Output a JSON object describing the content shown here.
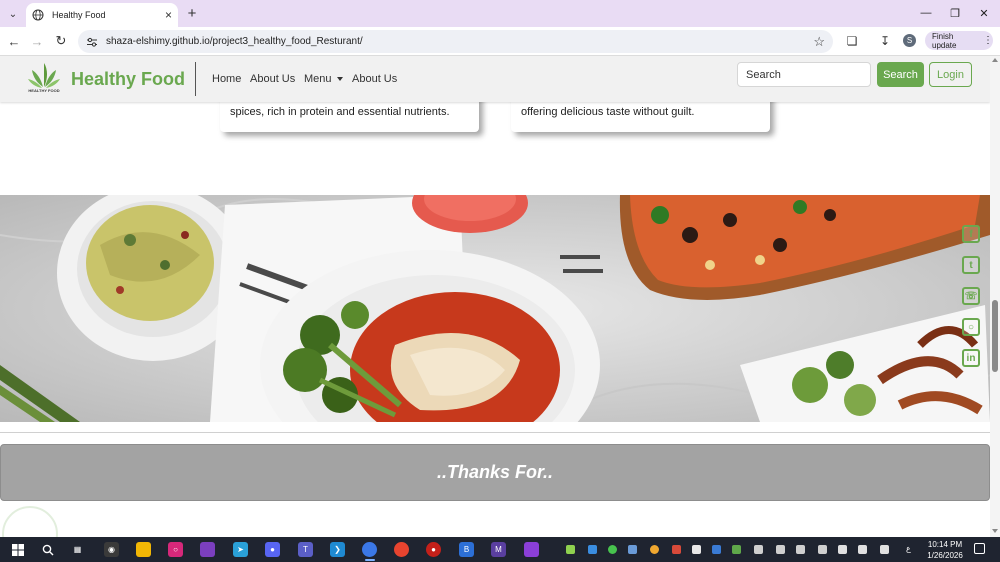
{
  "browser": {
    "tab_title": "Healthy Food",
    "url": "shaza-elshimy.github.io/project3_healthy_food_Resturant/",
    "finish_update_label": "Finish update",
    "profile_initial": "S"
  },
  "site": {
    "brand_name": "Healthy Food",
    "logo_text": "HEALTHY FOOD",
    "nav": {
      "home": "Home",
      "about_us_1": "About Us",
      "menu": "Menu",
      "about_us_2": "About Us"
    },
    "search_placeholder": "Search",
    "search_button": "Search",
    "login_button": "Login",
    "cards": [
      {
        "text": "spices, rich in protein and essential nutrients."
      },
      {
        "text": "offering delicious taste without guilt."
      }
    ],
    "thanks_text": "..Thanks For..",
    "social_icons": [
      "facebook-icon",
      "twitter-icon",
      "whatsapp-icon",
      "instagram-icon",
      "linkedin-icon"
    ]
  },
  "taskbar": {
    "time": "10:14 PM",
    "date": "1/26/2026",
    "language": "ع"
  },
  "colors": {
    "brand_green": "#6aa84f",
    "tab_strip": "#e9dcf4",
    "thanks_bar": "#a3a3a3",
    "taskbar": "#1f2430"
  }
}
